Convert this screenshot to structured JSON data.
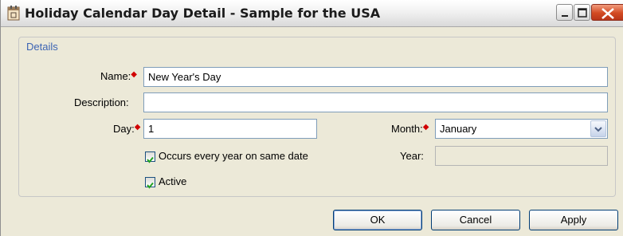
{
  "window": {
    "title": "Holiday Calendar Day Detail - Sample for the USA",
    "icons": {
      "app": "calendar-icon",
      "minimize": "minimize-icon",
      "maximize": "maximize-icon",
      "close": "close-icon"
    }
  },
  "details": {
    "legend": "Details",
    "name": {
      "label": "Name:",
      "value": "New Year's Day",
      "required": true
    },
    "description": {
      "label": "Description:",
      "value": ""
    },
    "day": {
      "label": "Day:",
      "value": "1",
      "required": true
    },
    "month": {
      "label": "Month:",
      "value": "January",
      "required": true
    },
    "occurs_every_year": {
      "label": "Occurs every year on same date",
      "checked": true
    },
    "year": {
      "label": "Year:",
      "value": ""
    },
    "active": {
      "label": "Active",
      "checked": true
    }
  },
  "buttons": {
    "ok": "OK",
    "cancel": "Cancel",
    "apply": "Apply"
  }
}
